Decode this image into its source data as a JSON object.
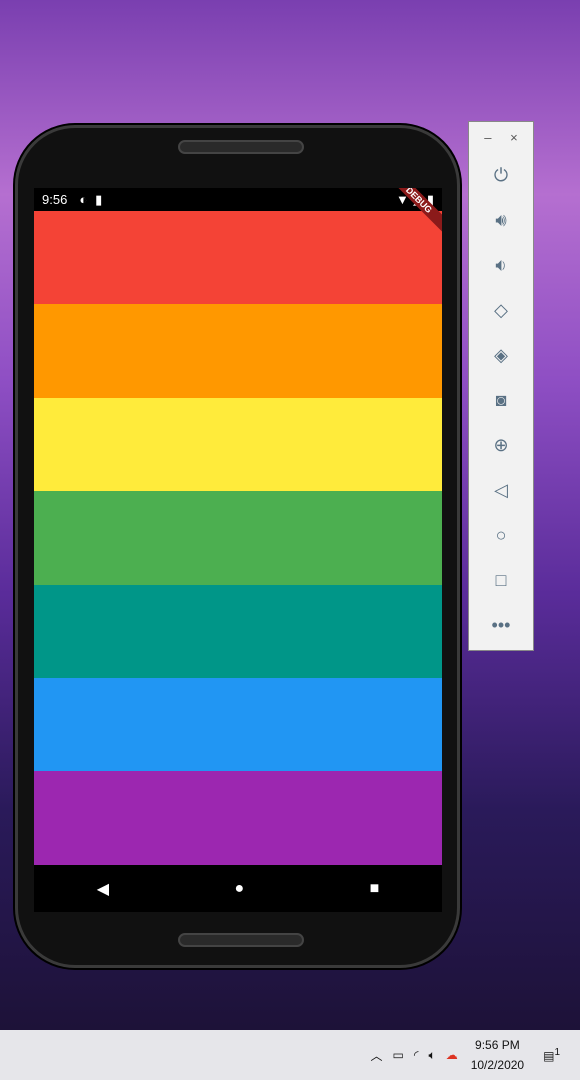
{
  "status_bar": {
    "time": "9:56",
    "debug_banner": "DEBUG"
  },
  "bands": [
    {
      "color": "#f44336"
    },
    {
      "color": "#ff9800"
    },
    {
      "color": "#ffeb3b"
    },
    {
      "color": "#4caf50"
    },
    {
      "color": "#009688"
    },
    {
      "color": "#2196f3"
    },
    {
      "color": "#9c27b0"
    }
  ],
  "emulator_toolbar": {
    "minimize": "–",
    "close": "×"
  },
  "taskbar": {
    "time": "9:56 PM",
    "date": "10/2/2020",
    "notification_count": "1"
  }
}
